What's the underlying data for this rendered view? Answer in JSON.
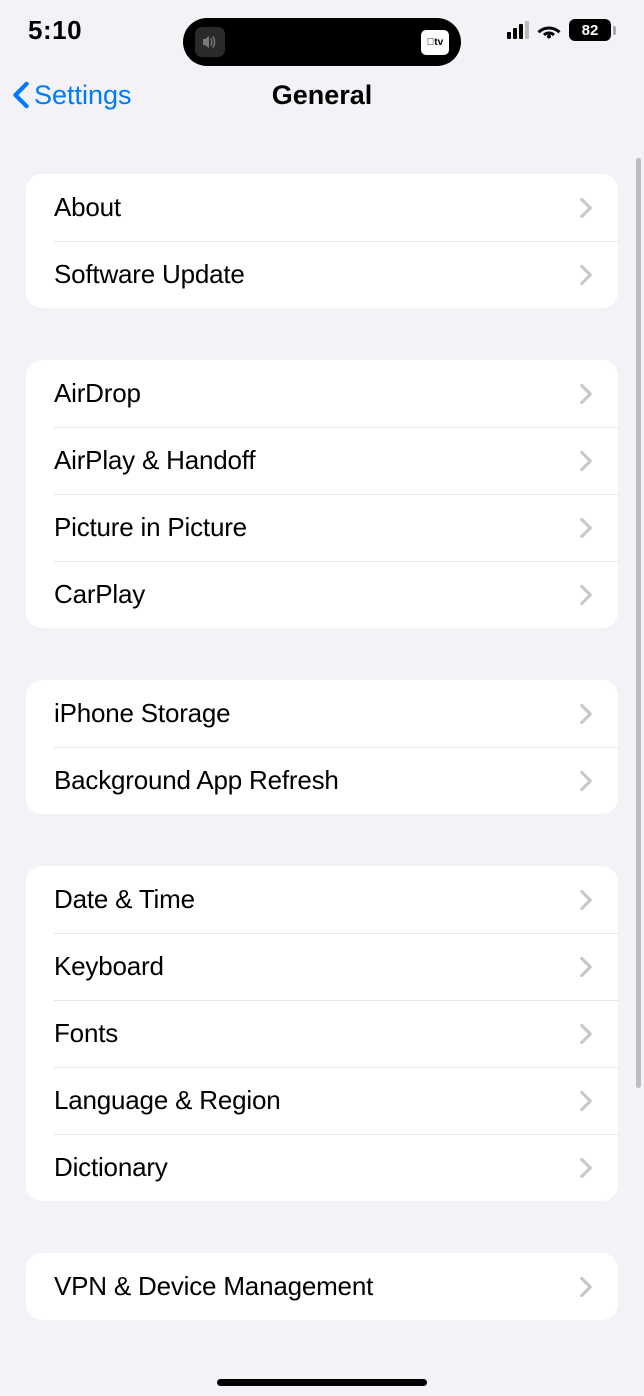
{
  "status_bar": {
    "time": "5:10",
    "battery_level": "82"
  },
  "nav": {
    "back_label": "Settings",
    "title": "General"
  },
  "sections": [
    {
      "rows": [
        {
          "label": "About"
        },
        {
          "label": "Software Update"
        }
      ]
    },
    {
      "rows": [
        {
          "label": "AirDrop"
        },
        {
          "label": "AirPlay & Handoff"
        },
        {
          "label": "Picture in Picture"
        },
        {
          "label": "CarPlay"
        }
      ]
    },
    {
      "rows": [
        {
          "label": "iPhone Storage"
        },
        {
          "label": "Background App Refresh"
        }
      ]
    },
    {
      "rows": [
        {
          "label": "Date & Time"
        },
        {
          "label": "Keyboard"
        },
        {
          "label": "Fonts"
        },
        {
          "label": "Language & Region"
        },
        {
          "label": "Dictionary"
        }
      ]
    },
    {
      "rows": [
        {
          "label": "VPN & Device Management"
        }
      ]
    }
  ]
}
